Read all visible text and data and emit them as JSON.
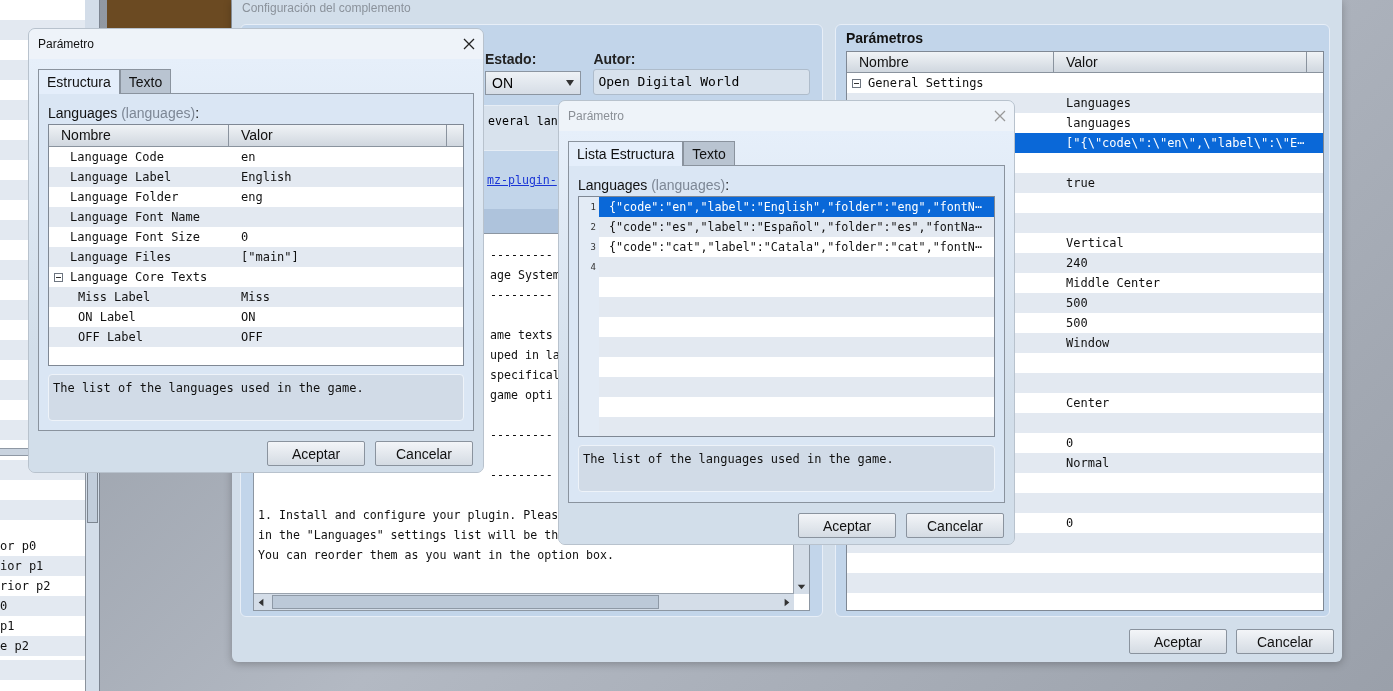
{
  "background_list": {
    "items": [
      "or p0",
      "ior p1",
      "rior p2",
      "0",
      "p1",
      "e p2"
    ]
  },
  "main_window": {
    "title": "Configuración del complemento",
    "estado": {
      "label": "Estado:",
      "value": "ON"
    },
    "autor": {
      "label": "Autor:",
      "value": "Open Digital World"
    },
    "description": "everal lan",
    "link": "mz-plugin-",
    "help_paragraphs": [
      {
        "kind": "fragment",
        "lines": [
          "---------",
          "age System",
          "---------"
        ]
      },
      {
        "kind": "fragment",
        "lines": [
          "ame texts",
          "uped in la",
          "specifical",
          "game opti"
        ]
      },
      {
        "kind": "fragment",
        "lines": [
          "---------"
        ]
      },
      {
        "kind": "fragment",
        "lines": [
          "---------"
        ]
      },
      {
        "kind": "full",
        "lines": [
          "1. Install and configure your plugin. Pleas",
          "in the \"Languages\" settings list will be th",
          "You can reorder them as you want in the option box."
        ]
      }
    ],
    "params": {
      "title": "Parámetros",
      "columns": [
        "Nombre",
        "Valor"
      ],
      "rows": [
        {
          "kind": "group",
          "name": "General Settings",
          "expanded": true,
          "selected": false,
          "children": [
            {
              "kind": "field",
              "value": "Languages",
              "selected": false
            },
            {
              "kind": "field",
              "value": "languages",
              "selected": false
            },
            {
              "kind": "field",
              "value": "[\"{\\\"code\\\":\\\"en\\\",\\\"label\\\":\\\"E⋯",
              "selected": true
            },
            {
              "kind": "field",
              "selected": false
            },
            {
              "kind": "field",
              "value": "true",
              "selected": false
            },
            {
              "kind": "field",
              "selected": false
            },
            {
              "kind": "field",
              "selected": false
            },
            {
              "kind": "field",
              "value": "Vertical",
              "selected": false
            },
            {
              "kind": "field",
              "value": "240",
              "selected": false
            },
            {
              "kind": "field",
              "value": "Middle Center",
              "selected": false
            },
            {
              "kind": "field",
              "value": "500",
              "selected": false
            },
            {
              "kind": "field",
              "value": "500",
              "selected": false
            },
            {
              "kind": "field",
              "value": "Window",
              "selected": false
            },
            {
              "kind": "field",
              "selected": false
            },
            {
              "kind": "field",
              "selected": false
            },
            {
              "kind": "field",
              "value": "Center",
              "selected": false
            },
            {
              "kind": "field",
              "selected": false
            },
            {
              "kind": "field",
              "value": "0",
              "selected": false
            },
            {
              "kind": "field",
              "value": "Normal",
              "selected": false
            },
            {
              "kind": "field",
              "selected": false
            },
            {
              "kind": "field",
              "selected": false
            },
            {
              "kind": "field",
              "value": "0",
              "selected": false
            }
          ]
        }
      ]
    },
    "buttons": [
      "Aceptar",
      "Cancelar"
    ]
  },
  "struct_dialog": {
    "title": "Parámetro",
    "active": true,
    "tabs": [
      {
        "label": "Estructura",
        "selected": true
      },
      {
        "label": "Texto",
        "selected": false
      }
    ],
    "field": {
      "name": "Languages",
      "key": "(languages)",
      "colon": ":"
    },
    "columns": [
      "Nombre",
      "Valor"
    ],
    "rows": [
      {
        "kind": "field",
        "name": "Language Code",
        "value": "en"
      },
      {
        "kind": "field",
        "name": "Language Label",
        "value": "English"
      },
      {
        "kind": "field",
        "name": "Language Folder",
        "value": "eng"
      },
      {
        "kind": "field",
        "name": "Language Font Name"
      },
      {
        "kind": "field",
        "name": "Language Font Size",
        "value": "0"
      },
      {
        "kind": "field",
        "name": "Language Files",
        "value": "[\"main\"]"
      },
      {
        "kind": "group",
        "name": "Language Core Texts",
        "expanded": true,
        "children": [
          {
            "kind": "field",
            "name": "Miss Label",
            "value": "Miss"
          },
          {
            "kind": "field",
            "name": "ON Label",
            "value": "ON"
          },
          {
            "kind": "field",
            "name": "OFF Label",
            "value": "OFF"
          }
        ]
      }
    ],
    "description": "The list of the languages used in the game.",
    "buttons": [
      "Aceptar",
      "Cancelar"
    ]
  },
  "list_dialog": {
    "title": "Parámetro",
    "active": false,
    "tabs": [
      {
        "label": "Lista Estructura",
        "selected": true
      },
      {
        "label": "Texto",
        "selected": false
      }
    ],
    "field": {
      "name": "Languages",
      "key": "(languages)",
      "colon": ":"
    },
    "items": [
      {
        "number": "1",
        "text": "{\"code\":\"en\",\"label\":\"English\",\"folder\":\"eng\",\"fontN⋯",
        "selected": true
      },
      {
        "number": "2",
        "text": "{\"code\":\"es\",\"label\":\"Español\",\"folder\":\"es\",\"fontNa⋯",
        "selected": false
      },
      {
        "number": "3",
        "text": "{\"code\":\"cat\",\"label\":\"Catala\",\"folder\":\"cat\",\"fontN⋯",
        "selected": false
      }
    ],
    "next_number": "4",
    "description": "The list of the languages used in the game.",
    "buttons": [
      "Aceptar",
      "Cancelar"
    ]
  }
}
